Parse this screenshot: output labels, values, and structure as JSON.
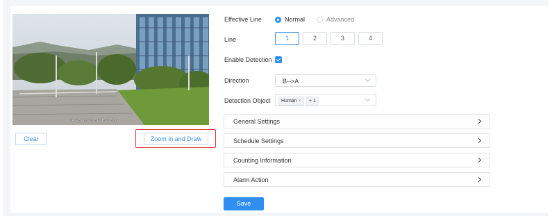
{
  "preview": {
    "osd_text": "04-28-2023 Fri 15:35:37"
  },
  "left_buttons": {
    "clear_label": "Clear",
    "zoom_draw_label": "Zoom in and Draw"
  },
  "form": {
    "effective_line": {
      "label": "Effective Line",
      "options": [
        "Normal",
        "Advanced"
      ],
      "selected": "Normal"
    },
    "line": {
      "label": "Line",
      "options": [
        "1",
        "2",
        "3",
        "4"
      ],
      "selected": "1"
    },
    "enable_detection": {
      "label": "Enable Detection",
      "checked": true
    },
    "direction": {
      "label": "Direction",
      "value": "B-->A"
    },
    "detection_object": {
      "label": "Detection Object",
      "tags": [
        "Human",
        "+ 1"
      ]
    }
  },
  "sections": [
    {
      "title": "General Settings"
    },
    {
      "title": "Schedule Settings"
    },
    {
      "title": "Counting Information"
    },
    {
      "title": "Alarm Action"
    }
  ],
  "save_label": "Save",
  "colors": {
    "accent": "#2f8ff0",
    "highlight": "#e03a3a",
    "page_bg": "#f4f5f7"
  }
}
